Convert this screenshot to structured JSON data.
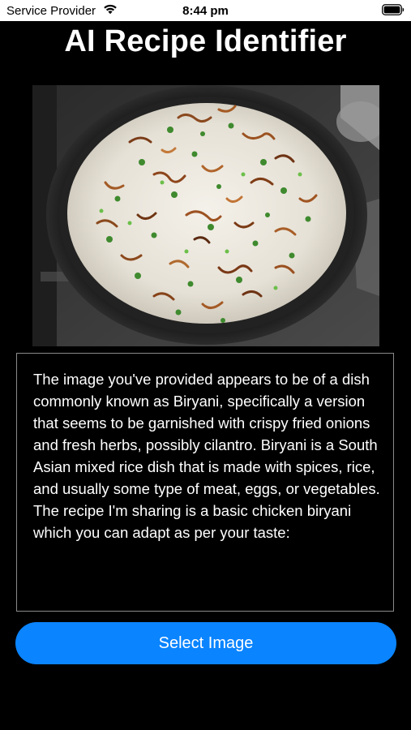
{
  "status_bar": {
    "carrier": "Service Provider",
    "time": "8:44 pm",
    "wifi_icon": "wifi-icon",
    "battery_icon": "battery-full-icon"
  },
  "header": {
    "title": "AI Recipe Identifier"
  },
  "photo": {
    "subject": "biryani-dish-photo"
  },
  "description": {
    "text": "The image you've provided appears to be of a dish commonly known as Biryani, specifically a version that seems to be garnished with crispy fried onions and fresh herbs, possibly cilantro. Biryani is a South Asian mixed rice dish that is made with spices, rice, and usually some type of meat, eggs, or vegetables. The recipe I'm sharing is a basic chicken biryani which you can adapt as per your taste:"
  },
  "actions": {
    "select_image_label": "Select Image"
  },
  "colors": {
    "background": "#000000",
    "accent": "#0a84ff",
    "text": "#ffffff",
    "border": "#8a8a8a"
  }
}
